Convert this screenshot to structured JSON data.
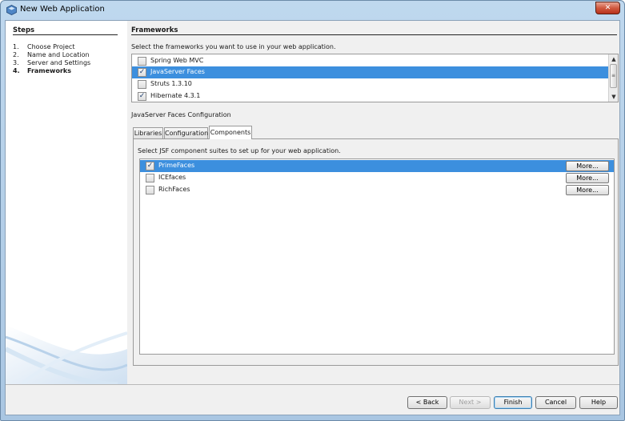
{
  "window": {
    "title": "New Web Application",
    "close_glyph": "✕"
  },
  "steps": {
    "heading": "Steps",
    "items": [
      {
        "num": "1.",
        "label": "Choose Project"
      },
      {
        "num": "2.",
        "label": "Name and Location"
      },
      {
        "num": "3.",
        "label": "Server and Settings"
      },
      {
        "num": "4.",
        "label": "Frameworks"
      }
    ],
    "current_index": 3
  },
  "frameworks": {
    "heading": "Frameworks",
    "instruction": "Select the frameworks you want to use in your web application.",
    "items": [
      {
        "label": "Spring Web MVC",
        "checked": false,
        "selected": false
      },
      {
        "label": "JavaServer Faces",
        "checked": true,
        "selected": true
      },
      {
        "label": "Struts 1.3.10",
        "checked": false,
        "selected": false
      },
      {
        "label": "Hibernate 4.3.1",
        "checked": true,
        "selected": false
      }
    ],
    "scrollbar": {
      "up": "▲",
      "down": "▼",
      "grip": "≡"
    }
  },
  "config": {
    "label": "JavaServer Faces Configuration",
    "tabs": [
      {
        "label": "Libraries",
        "active": false
      },
      {
        "label": "Configuration",
        "active": false
      },
      {
        "label": "Components",
        "active": true
      }
    ],
    "instruction": "Select JSF component suites to set up for your web application.",
    "components": [
      {
        "label": "PrimeFaces",
        "checked": true,
        "selected": true,
        "more": "More..."
      },
      {
        "label": "ICEfaces",
        "checked": false,
        "selected": false,
        "more": "More..."
      },
      {
        "label": "RichFaces",
        "checked": false,
        "selected": false,
        "more": "More..."
      }
    ]
  },
  "buttons": {
    "back": "< Back",
    "next": "Next >",
    "finish": "Finish",
    "cancel": "Cancel",
    "help": "Help"
  },
  "check_glyph": "✓",
  "colors": {
    "selection": "#3c8fde",
    "titlebar": "#bfd8ee",
    "close": "#c8452b"
  }
}
